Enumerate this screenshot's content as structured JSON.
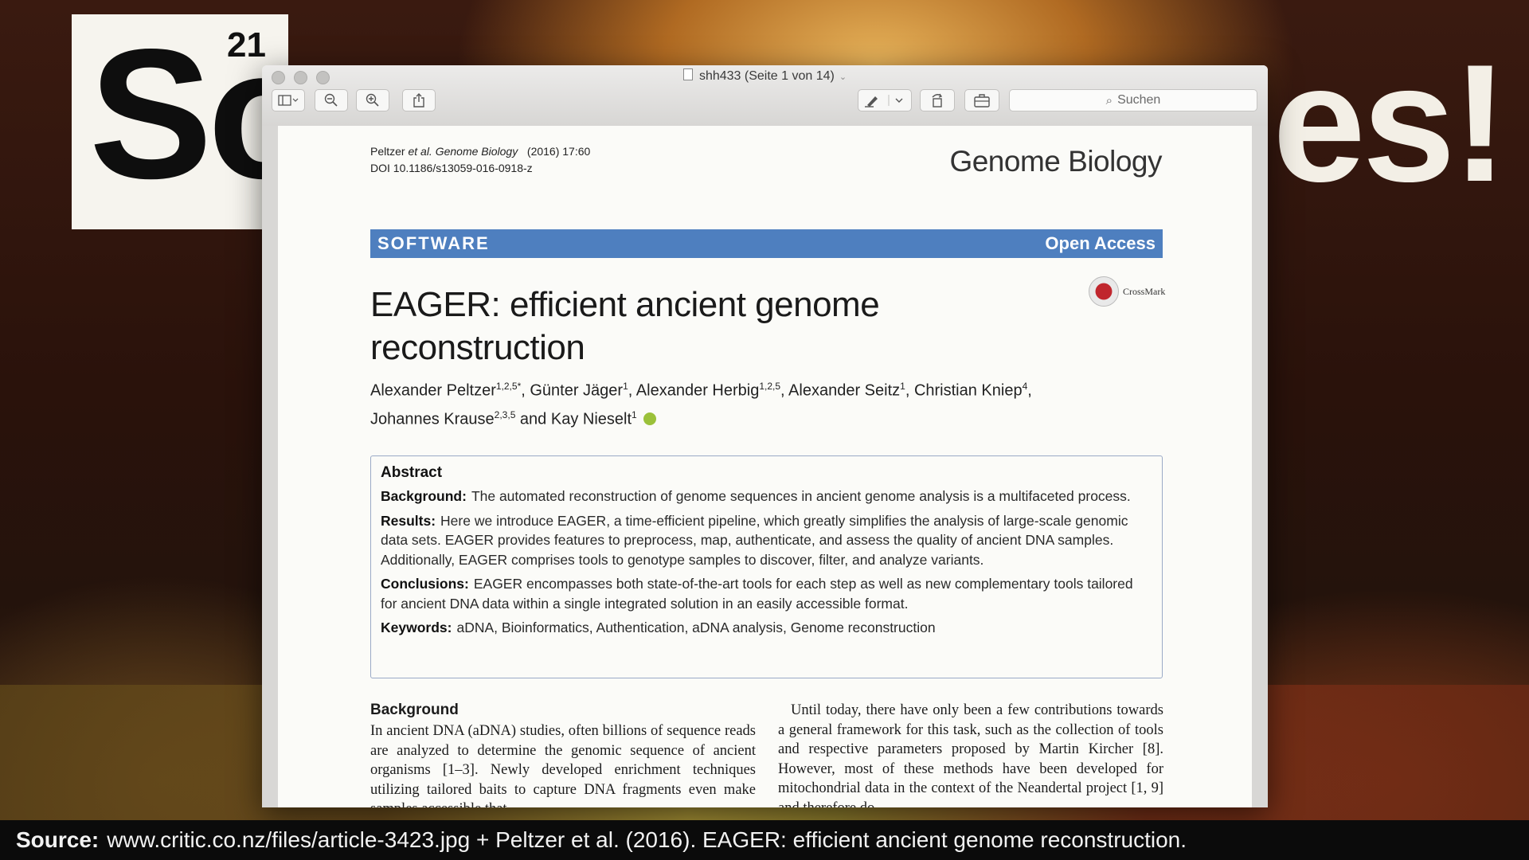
{
  "slide": {
    "number": "21",
    "left_text": "So",
    "right_text": "es!"
  },
  "window": {
    "title": "shh433 (Seite 1 von 14)",
    "search_placeholder": "Suchen",
    "toolbar": {
      "sidebar_icon": "sidebar-icon",
      "zoom_out_icon": "zoom-out-icon",
      "zoom_in_icon": "zoom-in-icon",
      "share_icon": "share-icon",
      "markup_icon": "pen-icon",
      "rotate_icon": "rotate-icon",
      "toolbox_icon": "toolbox-icon"
    }
  },
  "paper": {
    "citation_journal": "Genome Biology",
    "citation_year": "(2016) 17:60",
    "citation_authors": "Peltzer",
    "citation_etal": "et al.",
    "doi": "DOI 10.1186/s13059-016-0918-z",
    "journal": "Genome Biology",
    "category": "SOFTWARE",
    "access": "Open Access",
    "crossmark": "CrossMark",
    "title": "EAGER: efficient ancient genome reconstruction",
    "authors": [
      {
        "name": "Alexander Peltzer",
        "aff": "1,2,5*"
      },
      {
        "name": "Günter Jäger",
        "aff": "1"
      },
      {
        "name": "Alexander Herbig",
        "aff": "1,2,5"
      },
      {
        "name": "Alexander Seitz",
        "aff": "1"
      },
      {
        "name": "Christian Kniep",
        "aff": "4"
      },
      {
        "name": "Johannes Krause",
        "aff": "2,3,5"
      },
      {
        "name": "Kay Nieselt",
        "aff": "1"
      }
    ],
    "abstract": {
      "heading": "Abstract",
      "background_label": "Background:",
      "background": "The automated reconstruction of genome sequences in ancient genome analysis is a multifaceted process.",
      "results_label": "Results:",
      "results": "Here we introduce EAGER, a time-efficient pipeline, which greatly simplifies the analysis of large-scale genomic data sets. EAGER provides features to preprocess, map, authenticate, and assess the quality of ancient DNA samples. Additionally, EAGER comprises tools to genotype samples to discover, filter, and analyze variants.",
      "conclusions_label": "Conclusions:",
      "conclusions": "EAGER encompasses both state-of-the-art tools for each step as well as new complementary tools tailored for ancient DNA data within a single integrated solution in an easily accessible format.",
      "keywords_label": "Keywords:",
      "keywords": "aDNA, Bioinformatics, Authentication, aDNA analysis, Genome reconstruction"
    },
    "body_heading": "Background",
    "body_left": "In ancient DNA (aDNA) studies, often billions of sequence reads are analyzed to determine the genomic sequence of ancient organisms [1–3]. Newly developed enrichment techniques utilizing tailored baits to capture DNA fragments even make samples accessible that",
    "body_right": "Until today, there have only been a few contributions towards a general framework for this task, such as the collection of tools and respective parameters proposed by Martin Kircher [8]. However, most of these methods have been developed for mitochondrial data in the context of the Neandertal project [1, 9] and therefore do"
  },
  "caption": {
    "label": "Source:",
    "text": "www.critic.co.nz/files/article-3423.jpg + Peltzer et al. (2016). EAGER: efficient ancient genome reconstruction."
  }
}
